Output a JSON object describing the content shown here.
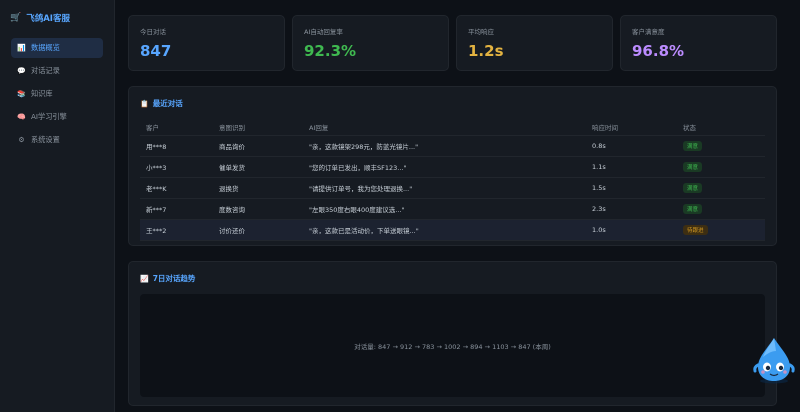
{
  "sidebar": {
    "brand_icon": "🛒",
    "brand": "飞鸽AI客服",
    "items": [
      {
        "icon": "📊",
        "label": "数据概览",
        "active": true
      },
      {
        "icon": "💬",
        "label": "对话记录",
        "active": false
      },
      {
        "icon": "📚",
        "label": "知识库",
        "active": false
      },
      {
        "icon": "🧠",
        "label": "AI学习引擎",
        "active": false
      },
      {
        "icon": "⚙",
        "label": "系统设置",
        "active": false
      }
    ]
  },
  "stats": [
    {
      "label": "今日对话",
      "value": "847",
      "color": "#58a6ff"
    },
    {
      "label": "AI自动回复率",
      "value": "92.3%",
      "color": "#3fb950"
    },
    {
      "label": "平均响应",
      "value": "1.2s",
      "color": "#e3b341"
    },
    {
      "label": "客户满意度",
      "value": "96.8%",
      "color": "#bc8cff"
    }
  ],
  "recent": {
    "icon": "📋",
    "title": "最近对话",
    "columns": [
      "客户",
      "意图识别",
      "AI回复",
      "响应时间",
      "状态"
    ],
    "rows": [
      {
        "customer": "用***8",
        "intent": "商品询价",
        "reply": "\"亲，这款镜架298元，防蓝光镜片...\"",
        "time": "0.8s",
        "status": "满意",
        "status_type": "ok"
      },
      {
        "customer": "小***3",
        "intent": "催单发货",
        "reply": "\"您的订单已发出，顺丰SF123...\"",
        "time": "1.1s",
        "status": "满意",
        "status_type": "ok"
      },
      {
        "customer": "老***K",
        "intent": "退换货",
        "reply": "\"请提供订单号，我为您处理退换...\"",
        "time": "1.5s",
        "status": "满意",
        "status_type": "ok"
      },
      {
        "customer": "新***7",
        "intent": "度数咨询",
        "reply": "\"左眼350度右眼400度建议选...\"",
        "time": "2.3s",
        "status": "满意",
        "status_type": "ok"
      },
      {
        "customer": "王***2",
        "intent": "讨价还价",
        "reply": "\"亲，这款已是活动价，下单送眼镜...\"",
        "time": "1.0s",
        "status": "待跟进",
        "status_type": "wait"
      }
    ]
  },
  "trend": {
    "icon": "📈",
    "title": "7日对话趋势",
    "summary": "对话量: 847 → 912 → 783 → 1002 → 894 → 1103 → 847 (本周)"
  },
  "mascot": {
    "icon": "water-drop-mascot-icon"
  }
}
